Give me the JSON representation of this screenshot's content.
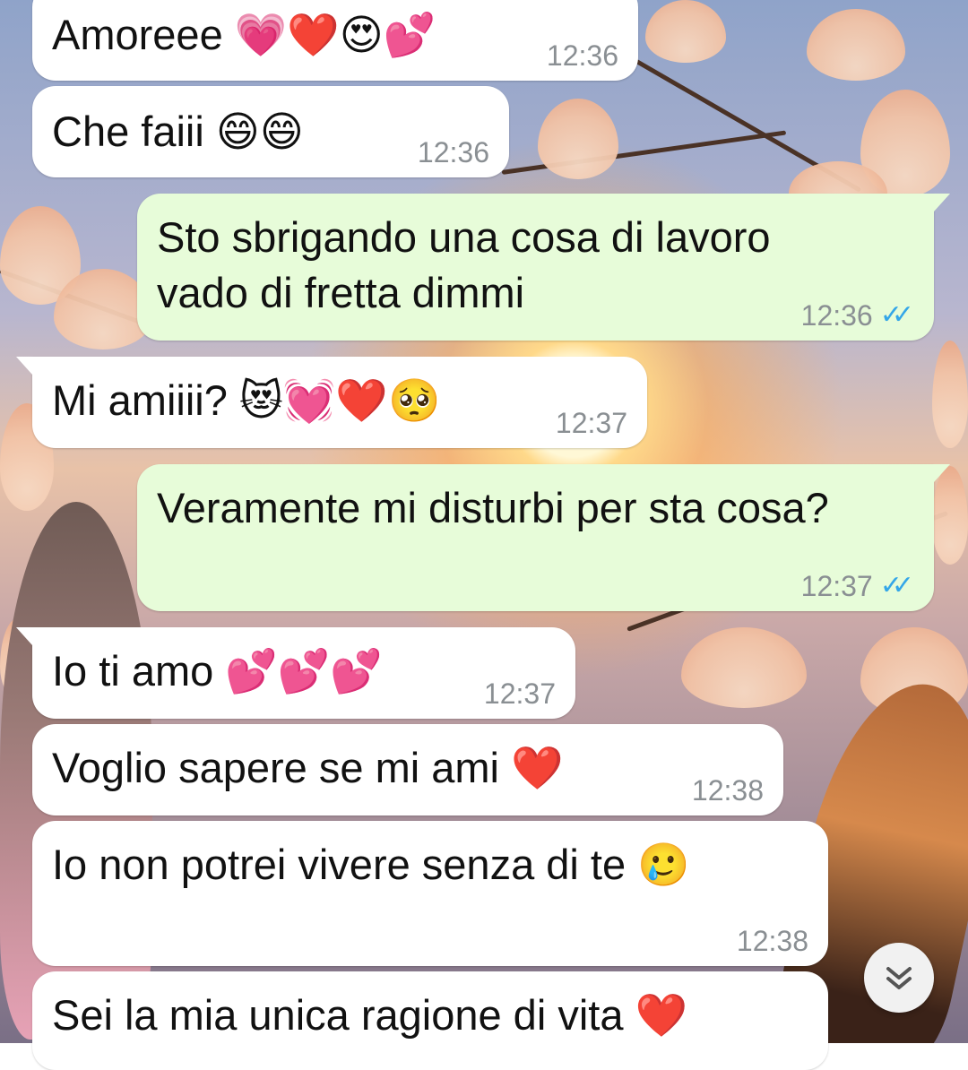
{
  "messages": [
    {
      "text": "Amoreee 💗❤️😍💕",
      "time": "12:36",
      "direction": "in"
    },
    {
      "text": "Che faiii 😄😄",
      "time": "12:36",
      "direction": "in"
    },
    {
      "text": "Sto sbrigando una cosa di lavoro\nvado di fretta dimmi",
      "time": "12:36",
      "direction": "out",
      "status": "read"
    },
    {
      "text": "Mi amiiii? 😻💓❤️🥺",
      "time": "12:37",
      "direction": "in"
    },
    {
      "text": "Veramente mi disturbi per sta cosa?",
      "time": "12:37",
      "direction": "out",
      "status": "read"
    },
    {
      "text": "Io ti amo 💕💕💕",
      "time": "12:37",
      "direction": "in"
    },
    {
      "text": "Voglio sapere se mi ami ❤️",
      "time": "12:38",
      "direction": "in"
    },
    {
      "text": "Io non potrei vivere senza di te 🥲",
      "time": "12:38",
      "direction": "in"
    },
    {
      "text": "Sei la mia unica ragione di vita ❤️",
      "time": "",
      "direction": "in"
    }
  ],
  "read_ticks": "✓✓",
  "scroll_button": {
    "icon": "double-chevron-down-icon",
    "glyph": "︾"
  },
  "colors": {
    "incoming": "#ffffff",
    "outgoing": "#e7fcd9",
    "read_ticks": "#34a6e8",
    "time": "#8a8f93"
  }
}
